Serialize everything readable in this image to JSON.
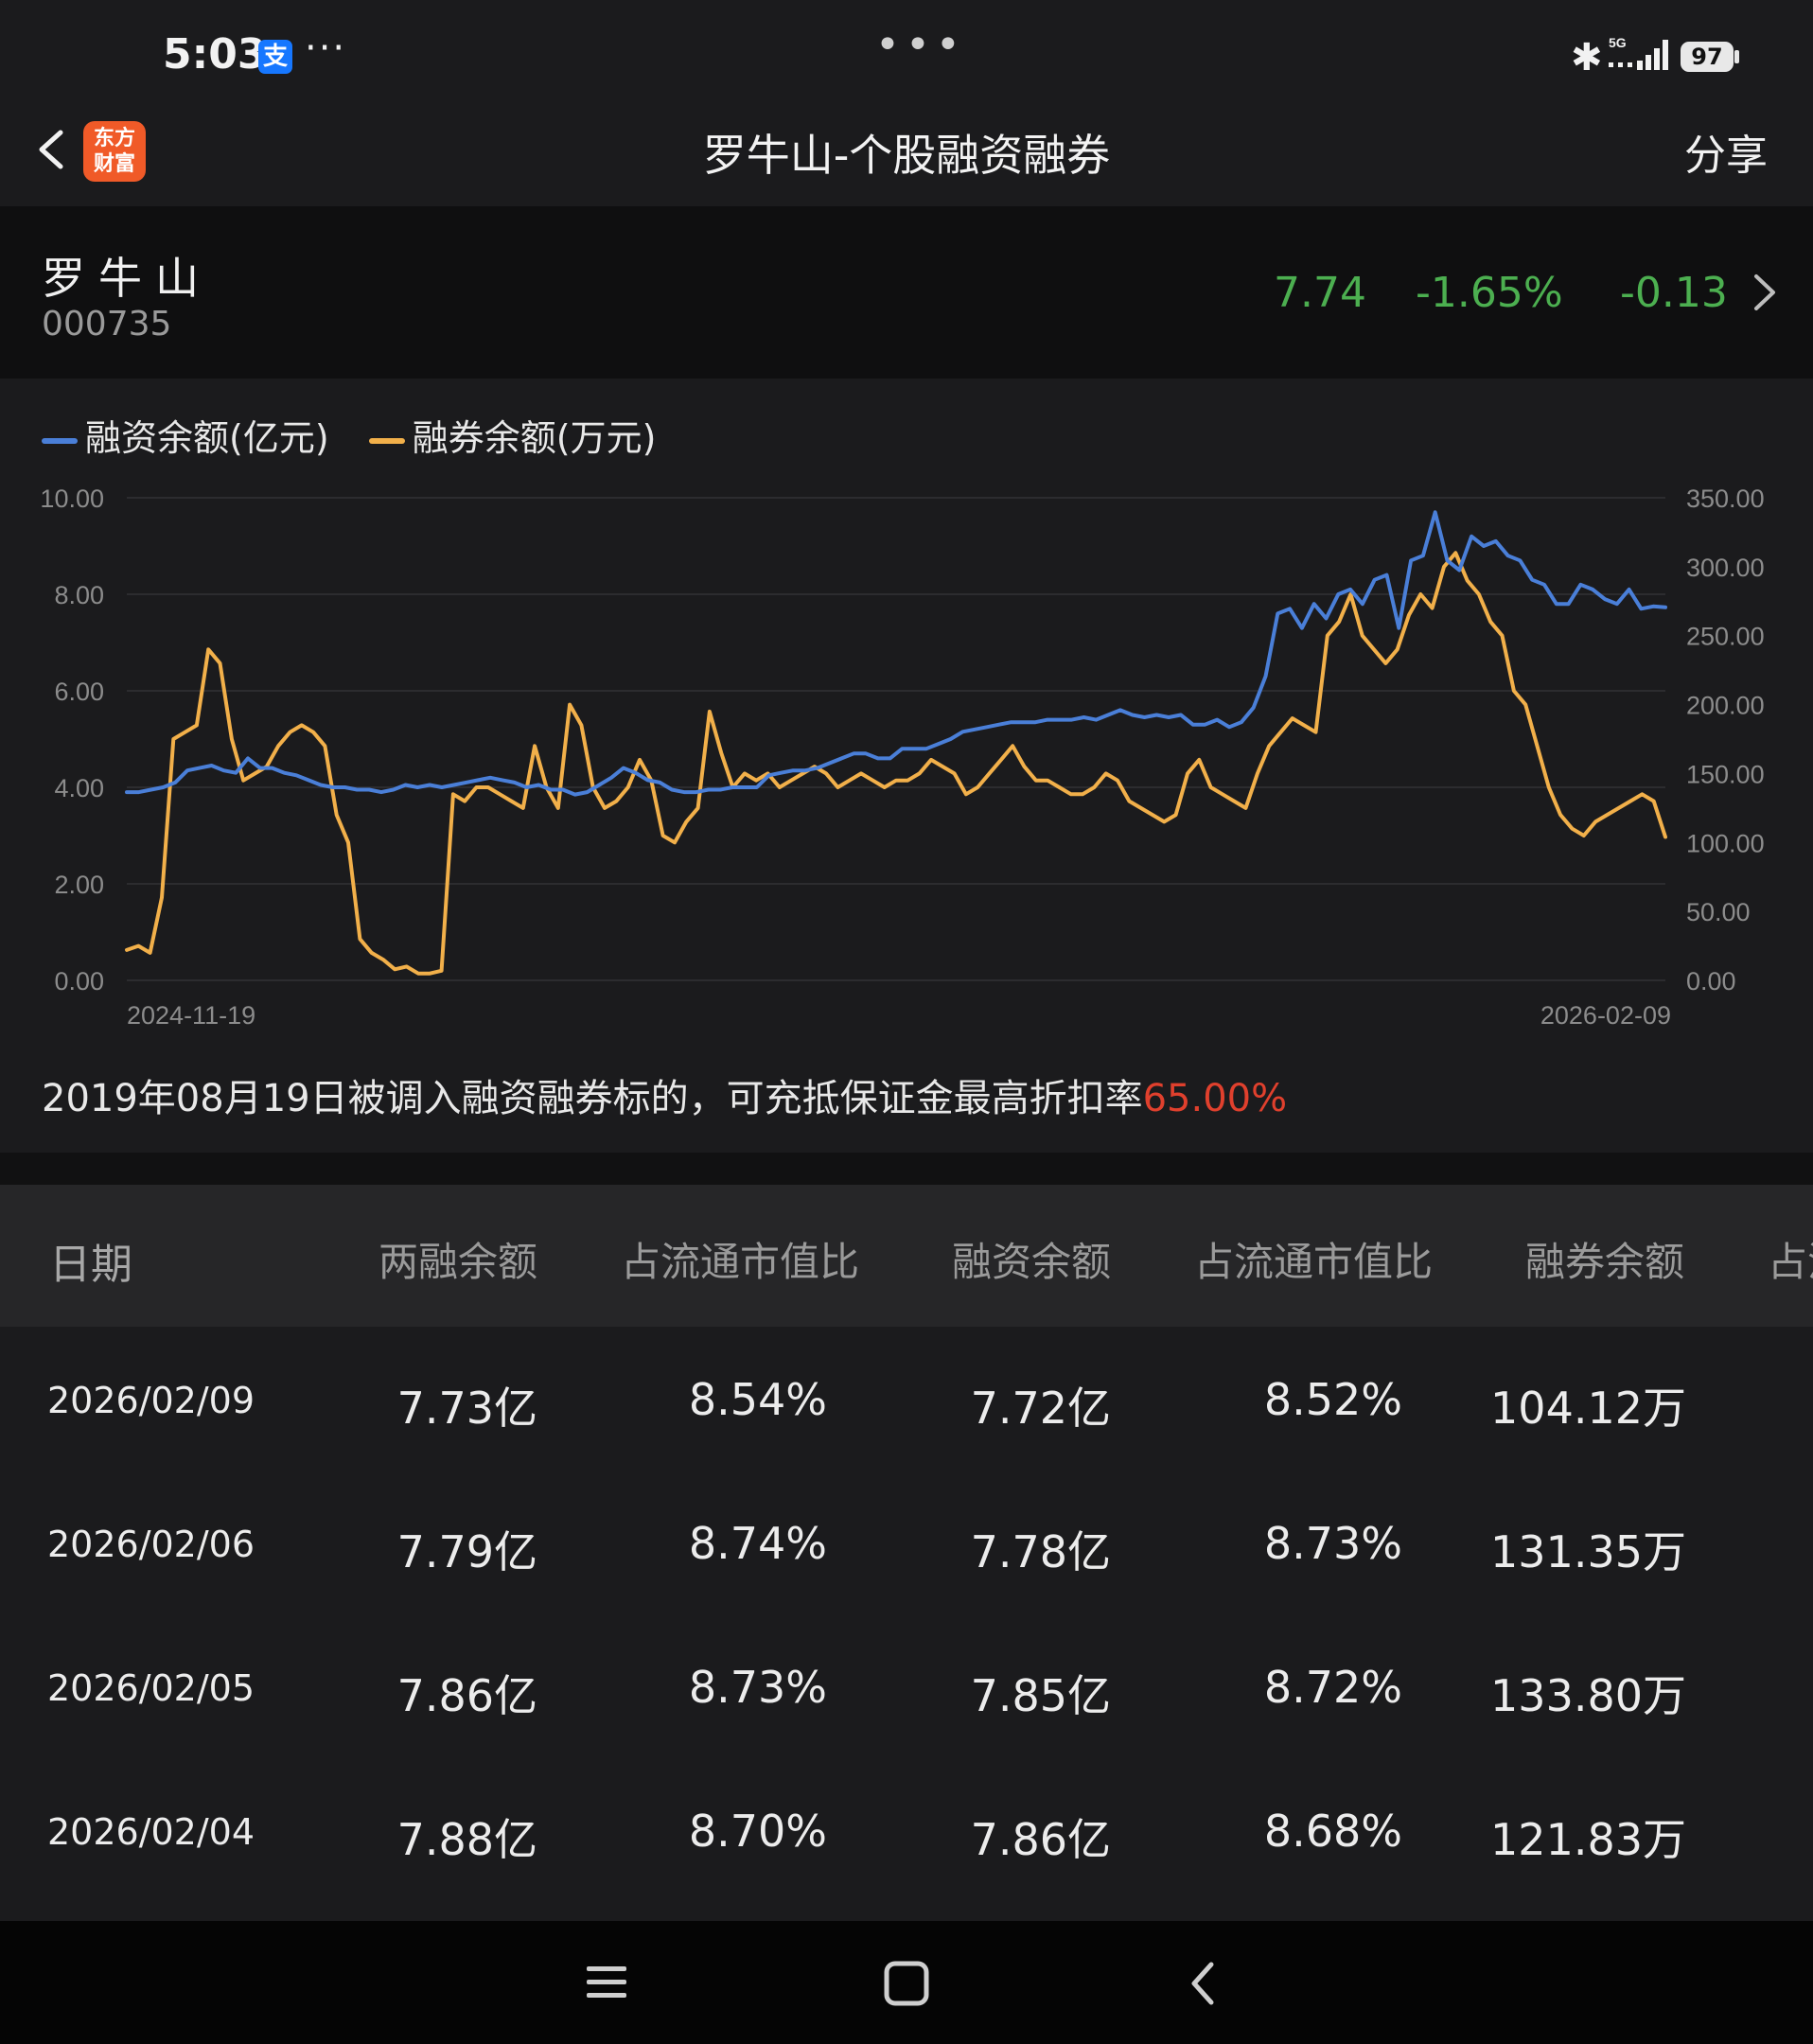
{
  "status_bar": {
    "time": "5:03",
    "app_badge": "支",
    "more": "···",
    "center_dots": "•••",
    "bluetooth_icon": "bluetooth-icon",
    "signal_label": "5G",
    "battery": "97"
  },
  "header": {
    "brand_line1": "东方",
    "brand_line2": "财富",
    "title": "罗牛山-个股融资融券",
    "share": "分享"
  },
  "stock": {
    "name": "罗牛山",
    "code": "000735",
    "price": "7.74",
    "change_pct": "-1.65%",
    "change": "-0.13",
    "quote_color": "#4caf50"
  },
  "legend": {
    "financing": "融资余额(亿元)",
    "lending": "融券余额(万元)",
    "financing_color": "#4a7fd8",
    "lending_color": "#f2b04a"
  },
  "chart_data": {
    "type": "line",
    "x_start": "2024-11-19",
    "x_end": "2026-02-09",
    "x_tick_labels": [
      "2024-11-19",
      "2026-02-09"
    ],
    "left_axis": {
      "ticks": [
        "0.00",
        "2.00",
        "4.00",
        "6.00",
        "8.00",
        "10.00"
      ],
      "ylim": [
        0,
        10
      ]
    },
    "right_axis": {
      "ticks": [
        "0.00",
        "50.00",
        "100.00",
        "150.00",
        "200.00",
        "250.00",
        "300.00",
        "350.00"
      ],
      "ylim": [
        0,
        350
      ]
    },
    "grid": true,
    "series": [
      {
        "name": "融资余额(亿元)",
        "axis": "left",
        "color": "#4a7fd8",
        "values": [
          3.9,
          3.9,
          3.95,
          4.0,
          4.1,
          4.35,
          4.4,
          4.45,
          4.35,
          4.3,
          4.6,
          4.4,
          4.4,
          4.3,
          4.25,
          4.15,
          4.05,
          4.0,
          4.0,
          3.95,
          3.95,
          3.9,
          3.95,
          4.05,
          4.0,
          4.05,
          4.0,
          4.05,
          4.1,
          4.15,
          4.2,
          4.15,
          4.1,
          4.0,
          4.05,
          3.95,
          3.95,
          3.85,
          3.9,
          4.05,
          4.2,
          4.4,
          4.3,
          4.15,
          4.1,
          3.95,
          3.9,
          3.9,
          3.95,
          3.95,
          4.0,
          4.0,
          4.0,
          4.25,
          4.3,
          4.35,
          4.35,
          4.4,
          4.5,
          4.6,
          4.7,
          4.7,
          4.6,
          4.6,
          4.8,
          4.8,
          4.8,
          4.9,
          5.0,
          5.15,
          5.2,
          5.25,
          5.3,
          5.35,
          5.35,
          5.35,
          5.4,
          5.4,
          5.4,
          5.45,
          5.4,
          5.5,
          5.6,
          5.5,
          5.45,
          5.5,
          5.45,
          5.5,
          5.3,
          5.3,
          5.4,
          5.25,
          5.35,
          5.65,
          6.3,
          7.6,
          7.7,
          7.3,
          7.8,
          7.5,
          8.0,
          8.1,
          7.8,
          8.3,
          8.4,
          7.3,
          8.7,
          8.8,
          9.7,
          8.7,
          8.5,
          9.2,
          9.0,
          9.1,
          8.8,
          8.7,
          8.3,
          8.2,
          7.8,
          7.8,
          8.2,
          8.1,
          7.9,
          7.8,
          8.1,
          7.7,
          7.75,
          7.73
        ]
      },
      {
        "name": "融券余额(万元)",
        "axis": "right",
        "color": "#f2b04a",
        "values": [
          22,
          25,
          20,
          60,
          175,
          180,
          185,
          240,
          230,
          175,
          145,
          150,
          155,
          170,
          180,
          185,
          180,
          170,
          120,
          100,
          30,
          20,
          15,
          8,
          10,
          5,
          5,
          7,
          135,
          130,
          140,
          140,
          135,
          130,
          125,
          170,
          140,
          125,
          200,
          185,
          140,
          125,
          130,
          140,
          160,
          145,
          105,
          100,
          115,
          125,
          195,
          165,
          140,
          150,
          145,
          150,
          140,
          145,
          150,
          155,
          150,
          140,
          145,
          150,
          145,
          140,
          145,
          145,
          150,
          160,
          155,
          150,
          135,
          140,
          150,
          160,
          170,
          155,
          145,
          145,
          140,
          135,
          135,
          140,
          150,
          145,
          130,
          125,
          120,
          115,
          120,
          150,
          160,
          140,
          135,
          130,
          125,
          150,
          170,
          180,
          190,
          185,
          180,
          250,
          260,
          280,
          250,
          240,
          230,
          240,
          265,
          280,
          270,
          300,
          310,
          290,
          280,
          260,
          250,
          210,
          200,
          170,
          140,
          120,
          110,
          105,
          115,
          120,
          125,
          130,
          135,
          130,
          104
        ]
      }
    ]
  },
  "note": {
    "text": "2019年08月19日被调入融资融券标的，可充抵保证金最高折扣率",
    "rate": "65.00%"
  },
  "table": {
    "headers": [
      "日期",
      "两融余额",
      "占流通市值比",
      "融资余额",
      "占流通市值比",
      "融券余额",
      "占流"
    ],
    "rows": [
      [
        "2026/02/09",
        "7.73亿",
        "8.54%",
        "7.72亿",
        "8.52%",
        "104.12万"
      ],
      [
        "2026/02/06",
        "7.79亿",
        "8.74%",
        "7.78亿",
        "8.73%",
        "131.35万"
      ],
      [
        "2026/02/05",
        "7.86亿",
        "8.73%",
        "7.85亿",
        "8.72%",
        "133.80万"
      ],
      [
        "2026/02/04",
        "7.88亿",
        "8.70%",
        "7.86亿",
        "8.68%",
        "121.83万"
      ]
    ]
  },
  "bottom_nav": {
    "menu_icon": "menu-icon",
    "home_icon": "home-icon",
    "back_icon": "back-icon"
  }
}
